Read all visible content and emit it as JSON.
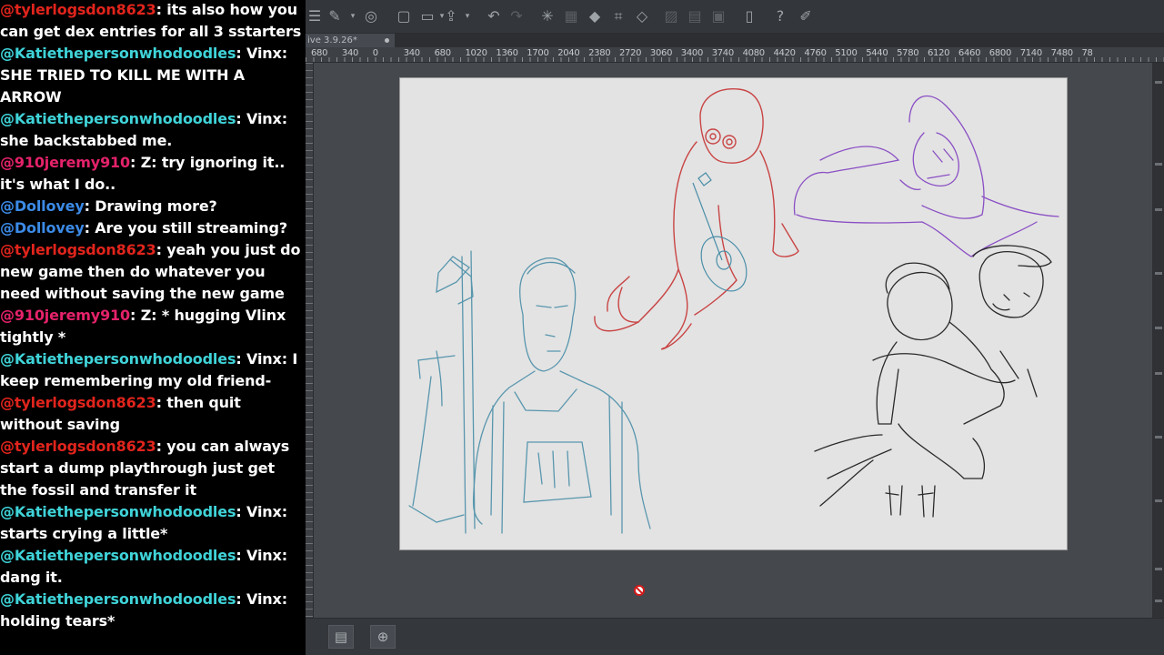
{
  "chat": {
    "messages": [
      {
        "user": "@tylerlogsdon8623",
        "color": "#e0241c",
        "text": ": its also how you can get dex entries for all 3 sstarters"
      },
      {
        "user": "@Katiethepersonwhodoodles",
        "color": "#3fd3d8",
        "text": ": Vinx: SHE TRIED TO KILL ME WITH A ARROW"
      },
      {
        "user": "@Katiethepersonwhodoodles",
        "color": "#3fd3d8",
        "text": ": Vinx: she backstabbed me."
      },
      {
        "user": "@910jeremy910",
        "color": "#e4226a",
        "text": ": Z: try ignoring it.. it's what I do.."
      },
      {
        "user": "@Dollovey",
        "color": "#3b8ae6",
        "text": ": Drawing more?"
      },
      {
        "user": "@Dollovey",
        "color": "#3b8ae6",
        "text": ": Are you still streaming?"
      },
      {
        "user": "@tylerlogsdon8623",
        "color": "#e0241c",
        "text": ": yeah you just do new game then do whatever you need without saving the new game"
      },
      {
        "user": "@910jeremy910",
        "color": "#e4226a",
        "text": ": Z: * hugging Vlinx tightly *"
      },
      {
        "user": "@Katiethepersonwhodoodles",
        "color": "#3fd3d8",
        "text": ": Vinx: I keep remembering my old friend-"
      },
      {
        "user": "@tylerlogsdon8623",
        "color": "#e0241c",
        "text": ": then quit without saving"
      },
      {
        "user": "@tylerlogsdon8623",
        "color": "#e0241c",
        "text": ": you can always start a dump playthrough just get the fossil and transfer it"
      },
      {
        "user": "@Katiethepersonwhodoodles",
        "color": "#3fd3d8",
        "text": ": Vinx: starts crying a little*"
      },
      {
        "user": "@Katiethepersonwhodoodles",
        "color": "#3fd3d8",
        "text": ": Vinx: dang it."
      },
      {
        "user": "@Katiethepersonwhodoodles",
        "color": "#3fd3d8",
        "text": ": Vinx: holding tears*"
      }
    ]
  },
  "app": {
    "doc_tab_label": "ive 3.9.26*",
    "ruler_labels": [
      "680",
      "340",
      "0",
      "340",
      "680",
      "1020",
      "1360",
      "1700",
      "2040",
      "2380",
      "2720",
      "3060",
      "3400",
      "3740",
      "4080",
      "4420",
      "4760",
      "5100",
      "5440",
      "5780",
      "6120",
      "6460",
      "6800",
      "7140",
      "7480",
      "78"
    ],
    "toolbar_icons": [
      "menu-icon",
      "transform-icon",
      "chevron-down-icon",
      "spiral-icon",
      "new-layer-icon",
      "open-folder-icon",
      "chevron-down-icon",
      "export-icon",
      "chevron-down-icon",
      "undo-icon",
      "redo-icon",
      "loading-spinner-icon",
      "select-icon",
      "fill-icon",
      "crop-icon",
      "transform-grid-icon",
      "hatch-icon",
      "ruler-icon",
      "frame-icon",
      "device-icon",
      "help-icon",
      "pen-settings-icon"
    ],
    "bottom_icons": [
      "panel-toggle-icon",
      "navigator-icon"
    ],
    "accent_colors": {
      "red_sketch": "#c94444",
      "blue_sketch": "#4a8ea8",
      "purple_sketch": "#8a4fc4",
      "black_sketch": "#2a2a2a"
    }
  }
}
